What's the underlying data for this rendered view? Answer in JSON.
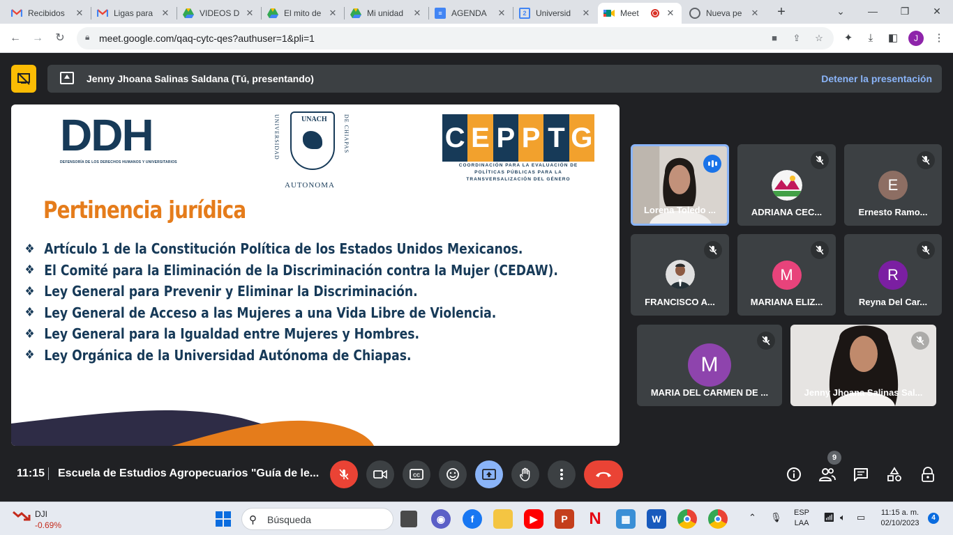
{
  "browser": {
    "tabs": [
      {
        "label": "Recibidos",
        "icon": "gmail-icon",
        "color": "#ea4335"
      },
      {
        "label": "Ligas para",
        "icon": "gmail-icon",
        "color": "#ea4335"
      },
      {
        "label": "VIDEOS D",
        "icon": "drive-icon",
        "color": "#34a853"
      },
      {
        "label": "El mito de",
        "icon": "drive-icon",
        "color": "#34a853"
      },
      {
        "label": "Mi unidad",
        "icon": "drive-icon",
        "color": "#34a853"
      },
      {
        "label": "AGENDA",
        "icon": "docs-icon",
        "color": "#4285f4"
      },
      {
        "label": "Universid",
        "icon": "calendar-icon",
        "color": "#4285f4"
      },
      {
        "label": "Meet",
        "icon": "meet-icon",
        "color": "#00897b",
        "active": true
      },
      {
        "label": "Nueva pe",
        "icon": "globe-icon",
        "color": "#5f6368"
      }
    ],
    "url": "meet.google.com/qaq-cytc-qes?authuser=1&pli=1",
    "profile_initial": "J"
  },
  "presentation": {
    "presenter_text": "Jenny Jhoana Salinas Saldana (Tú, presentando)",
    "stop_label": "Detener la presentación"
  },
  "slide": {
    "logo_ddh": "DDH",
    "logo_ddh_sub": "DEFENSORÍA DE LOS DERECHOS HUMANOS Y UNIVERSITARIOS",
    "unach_left": "UNIVERSIDAD",
    "unach_right": "DE CHIAPAS",
    "unach_shield": "UNACH",
    "unach_bottom": "AUTONOMA",
    "cepptg_letters": [
      "C",
      "E",
      "P",
      "P",
      "T",
      "G"
    ],
    "cepptg_line1": "COORDINACIÓN PARA LA EVALUACIÓN DE",
    "cepptg_line2": "POLÍTICAS PÚBLICAS PARA LA",
    "cepptg_line3": "TRANSVERSALIZACIÓN DEL GÉNERO",
    "title": "Pertinencia jurídica",
    "bullets": [
      "Artículo 1 de la Constitución Política de los Estados Unidos Mexicanos.",
      "El Comité para la Eliminación de la Discriminación contra la Mujer (CEDAW).",
      "Ley General para Prevenir y Eliminar la Discriminación.",
      "Ley General de Acceso a las Mujeres a una Vida Libre de Violencia.",
      "Ley General para la Igualdad entre Mujeres y Hombres.",
      "Ley Orgánica de la Universidad Autónoma de Chiapas."
    ]
  },
  "participants": [
    {
      "name": "Lorena Toledo ...",
      "type": "video",
      "speaking": true
    },
    {
      "name": "ADRIANA CEC...",
      "type": "photo",
      "muted": true
    },
    {
      "name": "Ernesto Ramo...",
      "type": "initial",
      "initial": "E",
      "color": "#8d6e63",
      "muted": true
    },
    {
      "name": "FRANCISCO A...",
      "type": "photo",
      "muted": true
    },
    {
      "name": "MARIANA ELIZ...",
      "type": "initial",
      "initial": "M",
      "color": "#e8437b",
      "muted": true
    },
    {
      "name": "Reyna Del Car...",
      "type": "initial",
      "initial": "R",
      "color": "#7b1fa2",
      "muted": true
    },
    {
      "name": "MARIA DEL CARMEN DE ...",
      "type": "initial",
      "initial": "M",
      "color": "#8e44ad",
      "muted": true
    },
    {
      "name": "Jenny Jhoana Salinas Sal...",
      "type": "video",
      "muted": true
    }
  ],
  "meeting": {
    "time": "11:15",
    "title": "Escuela de Estudios Agropecuarios \"Guía de le...",
    "participant_count": "9"
  },
  "taskbar": {
    "stock_name": "DJI",
    "stock_change": "-0.69%",
    "search_placeholder": "Búsqueda",
    "lang_line1": "ESP",
    "lang_line2": "LAA",
    "time": "11:15 a. m.",
    "date": "02/10/2023",
    "notifications": "4"
  }
}
